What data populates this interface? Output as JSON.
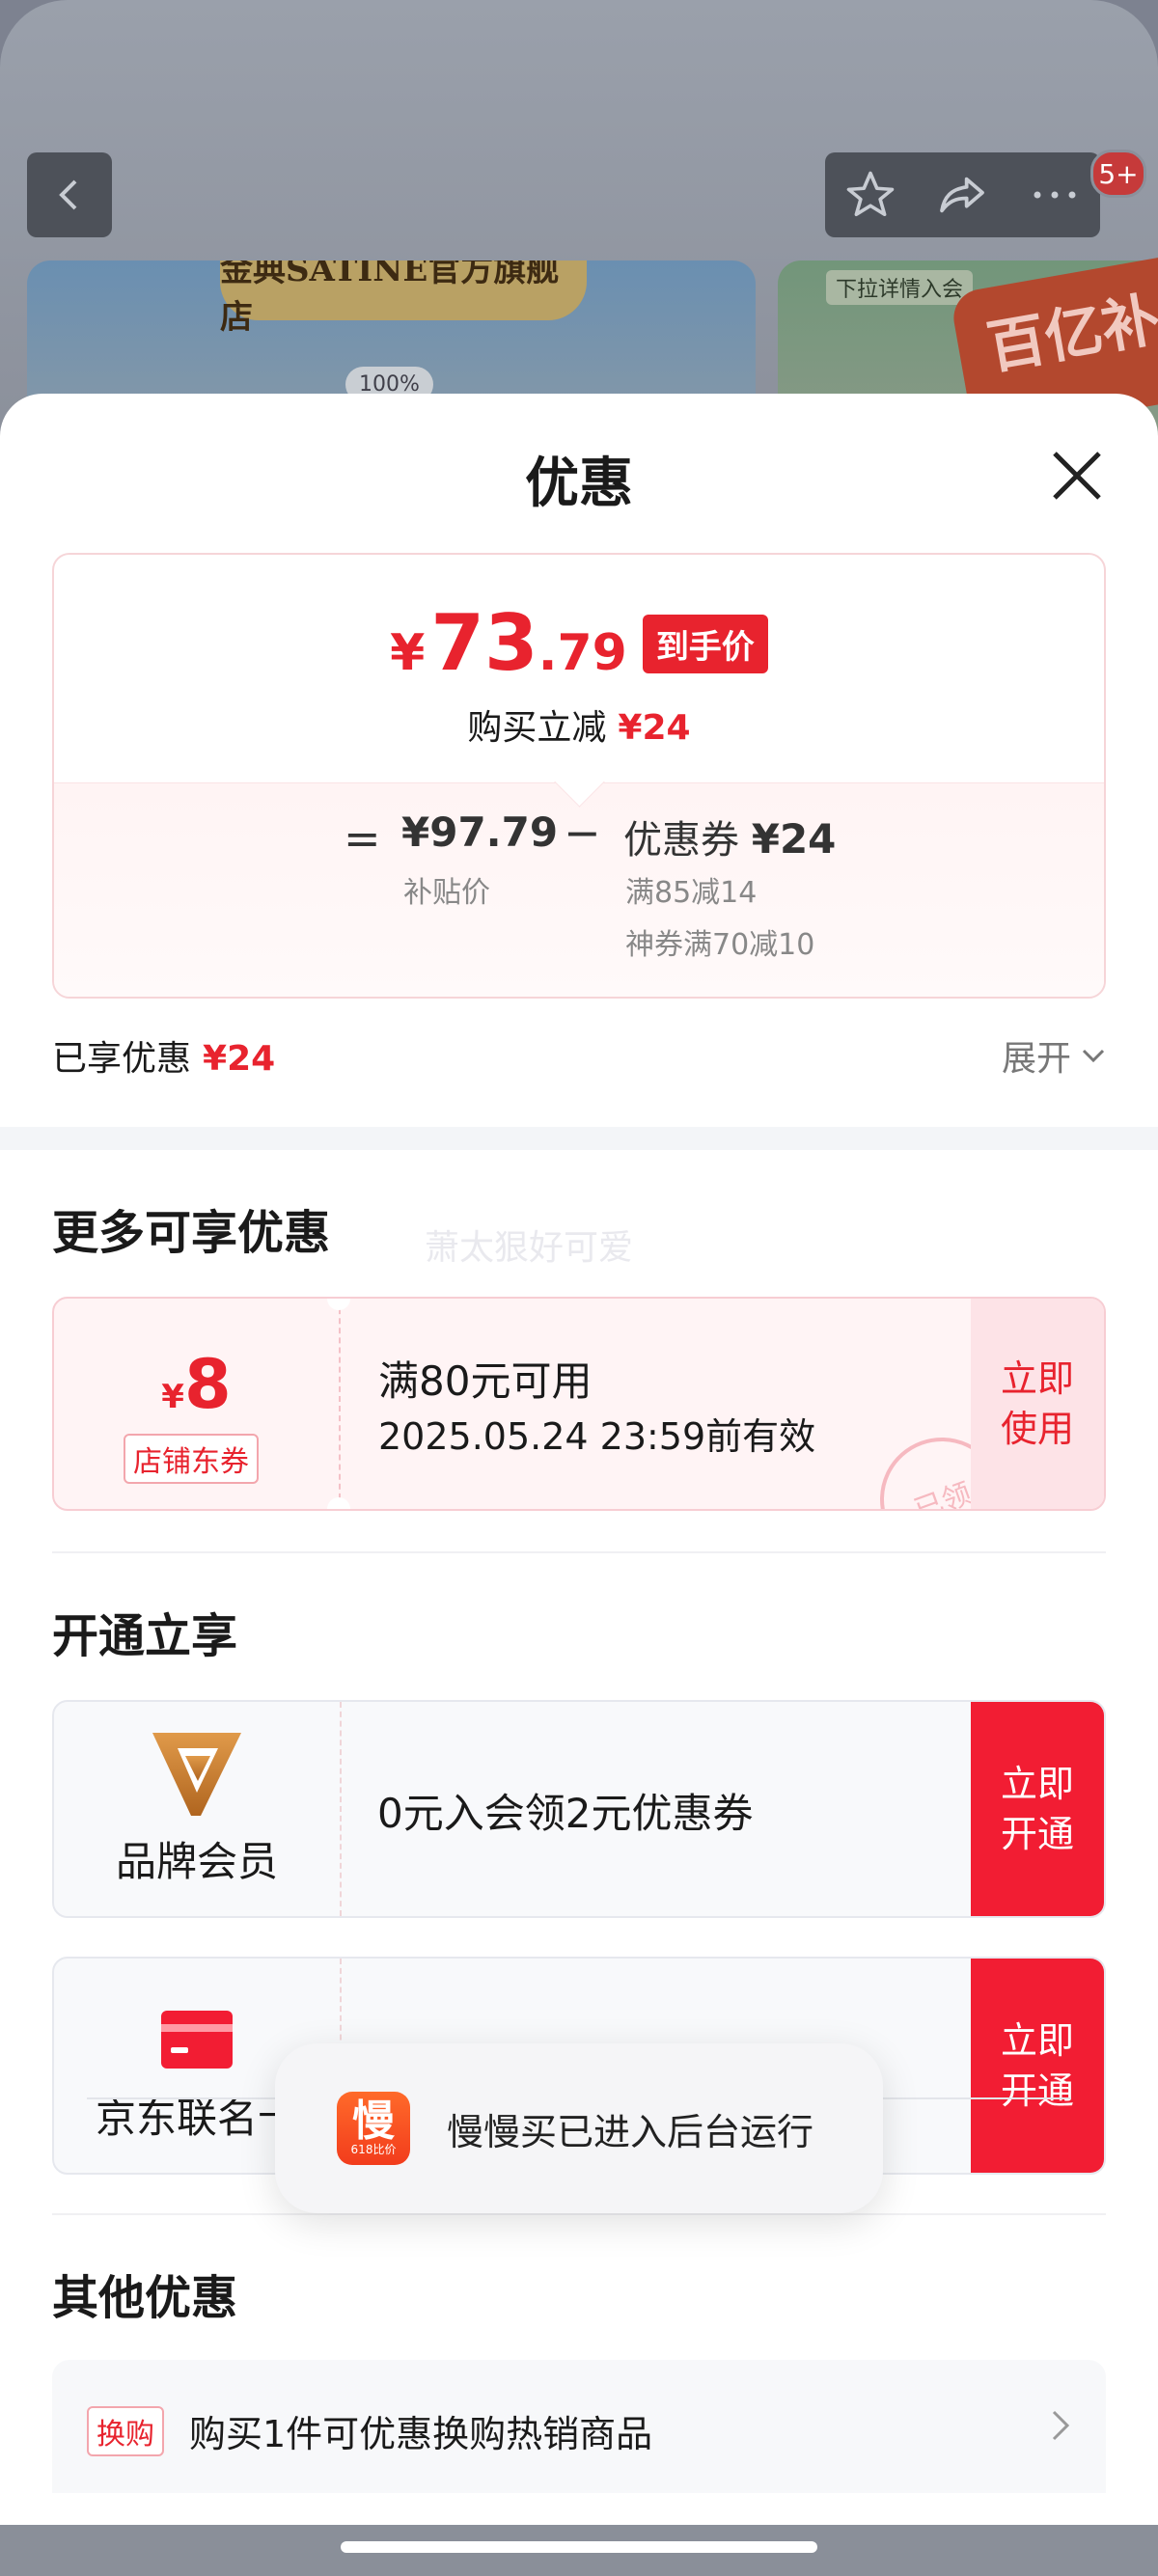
{
  "background": {
    "store_name": "金典SATINE官方旗舰店",
    "banner_percent": "100%",
    "banner2_tip": "下拉详情入会",
    "subsidy_badge": "百亿补贴",
    "notification_badge": "5+"
  },
  "sheet": {
    "title": "优惠",
    "price_card": {
      "currency": "¥",
      "price_int": "73",
      "price_dec": ".79",
      "price_tag": "到手价",
      "reduce_label": "购买立减",
      "reduce_value": "¥24",
      "equals": "=",
      "subsidy_price": "¥97.79",
      "subsidy_label": "补贴价",
      "minus": "−",
      "coupon_label": "优惠券",
      "coupon_value": "¥24",
      "coupon_detail_1": "满85减14",
      "coupon_detail_2": "神券满70减10"
    },
    "enjoyed_label": "已享优惠",
    "enjoyed_value": "¥24",
    "expand_label": "展开"
  },
  "more_offers": {
    "heading": "更多可享优惠",
    "watermark": "萧太狠好可爱",
    "coupon": {
      "currency": "¥",
      "amount": "8",
      "type": "店铺东券",
      "condition": "满80元可用",
      "valid_until": "2025.05.24 23:59前有效",
      "stamp": "已领",
      "button": "立即\n使用"
    }
  },
  "membership": {
    "heading": "开通立享",
    "cards": [
      {
        "name": "品牌会员",
        "text": "0元入会领2元优惠券",
        "button": "立即\n开通"
      },
      {
        "name": "京东联名卡",
        "text": "",
        "button": "立即\n开通"
      }
    ]
  },
  "toast": {
    "app_logo_char": "慢",
    "app_logo_sub": "618比价",
    "message": "慢慢买已进入后台运行"
  },
  "other_offers": {
    "heading": "其他优惠",
    "items": [
      {
        "tag": "换购",
        "text": "购买1件可优惠换购热销商品"
      }
    ]
  },
  "colors": {
    "accent_red": "#e8232e",
    "button_red": "#f21d33",
    "toast_logo": "#f23c1c"
  }
}
